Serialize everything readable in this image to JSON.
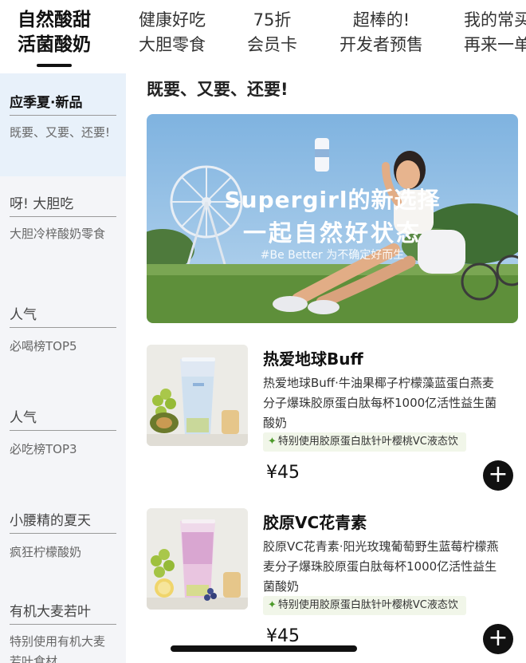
{
  "tabs": [
    {
      "line1": "自然酸甜",
      "line2": "活菌酸奶"
    },
    {
      "line1": "健康好吃",
      "line2": "大胆零食"
    },
    {
      "line1": "75折",
      "line2": "会员卡"
    },
    {
      "line1": "超棒的!",
      "line2": "开发者预售"
    },
    {
      "line1": "我的常买",
      "line2": "再来一单"
    }
  ],
  "sidebar": {
    "groups": [
      {
        "title": "应季夏·新品",
        "desc": "既要、又要、还要!"
      },
      {
        "title": "呀! 大胆吃",
        "desc": "大胆冷梓酸奶零食"
      },
      {
        "title": "人气",
        "desc": "必喝榜TOP5"
      },
      {
        "title": "人气",
        "desc": "必吃榜TOP3"
      },
      {
        "title": "小腰精的夏天",
        "desc": "疯狂柠檬酸奶"
      },
      {
        "title": "有机大麦若叶",
        "desc": "特别使用有机大麦若叶食材"
      }
    ]
  },
  "main": {
    "section_title": "既要、又要、还要!",
    "banner": {
      "headline1": "Supergirl的新选择",
      "headline2": "一起自然好状态",
      "subline": "#Be Better 为不确定好而生"
    },
    "products": [
      {
        "name": "热爱地球Buff",
        "desc": "热爱地球Buff·牛油果椰子柠檬藻蓝蛋白燕麦分子爆珠胶原蛋白肽每杯1000亿活性益生菌酸奶",
        "tag": "特别使用胶原蛋白肽针叶樱桃VC液态饮",
        "price": "¥45",
        "add_label": "+"
      },
      {
        "name": "胶原VC花青素",
        "desc": "胶原VC花青素·阳光玫瑰葡萄野生蓝莓柠檬燕麦分子爆珠胶原蛋白肽每杯1000亿活性益生菌酸奶",
        "tag": "特别使用胶原蛋白肽针叶樱桃VC液态饮",
        "price": "¥45",
        "add_label": "+"
      }
    ]
  },
  "colors": {
    "accent": "#111111",
    "sidebar_bg": "#f4f5f8",
    "sidebar_active_bg": "#e8f1fa",
    "tag_bg": "#f1f6e9",
    "leaf_green": "#4c9a2a"
  },
  "icons": {
    "add": "plus-icon",
    "leaf": "leaf-icon"
  }
}
